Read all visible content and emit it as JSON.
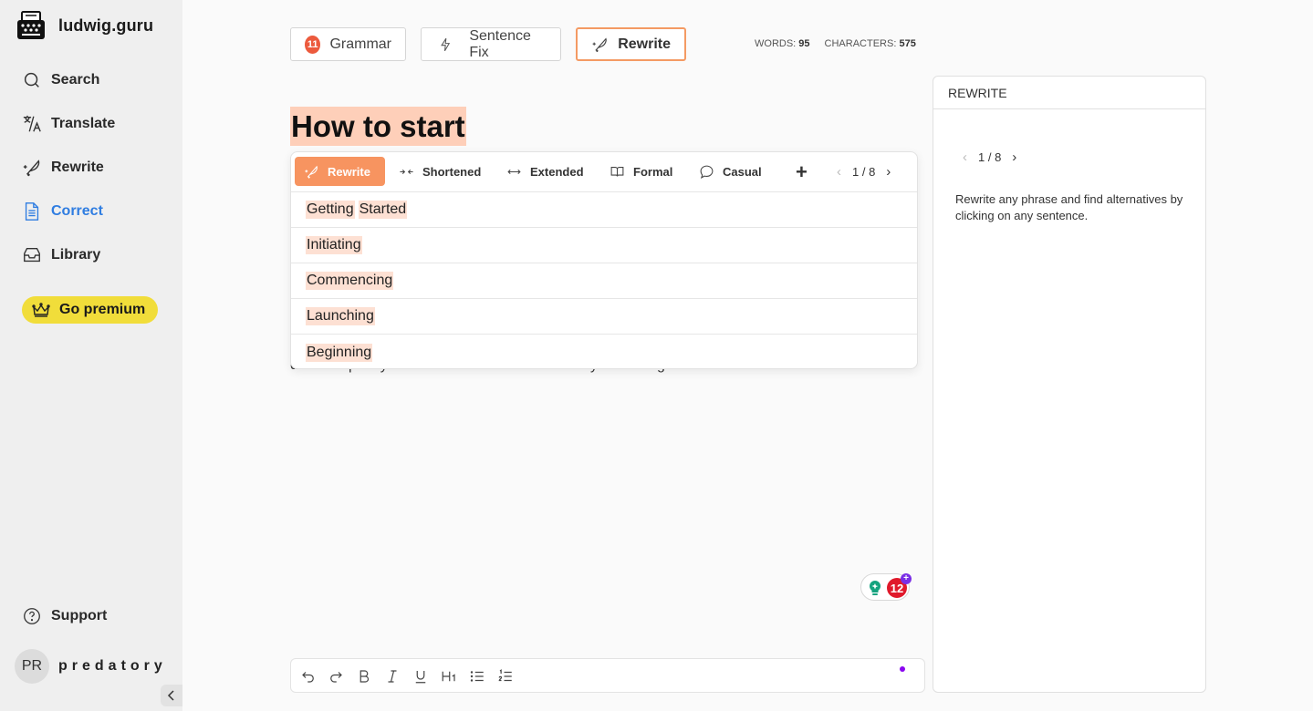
{
  "app": {
    "name": "ludwig.guru"
  },
  "sidebar": {
    "items": [
      {
        "label": "Search",
        "icon": "search-icon"
      },
      {
        "label": "Translate",
        "icon": "translate-icon"
      },
      {
        "label": "Rewrite",
        "icon": "quill-sparkle-icon"
      },
      {
        "label": "Correct",
        "icon": "document-icon",
        "active": true
      },
      {
        "label": "Library",
        "icon": "inbox-icon"
      }
    ],
    "premium_label": "Go premium",
    "support_label": "Support",
    "user": {
      "initials": "PR",
      "name": "predatory"
    }
  },
  "toolbar": {
    "grammar": {
      "label": "Grammar",
      "count": "11"
    },
    "sentence_fix": {
      "label": "Sentence Fix"
    },
    "rewrite": {
      "label": "Rewrite",
      "active": true
    },
    "words_label": "WORDS:",
    "words": "95",
    "characters_label": "CHARACTERS:",
    "characters": "575"
  },
  "editor": {
    "title": "How to start",
    "visible_paragraph_fragment": "discover plenty of rewrite alternatives to make your writing flow even smoother."
  },
  "rewrite_popup": {
    "tabs": [
      {
        "label": "Rewrite",
        "icon": "quill-sparkle-icon",
        "active": true
      },
      {
        "label": "Shortened",
        "icon": "shorten-arrows-icon"
      },
      {
        "label": "Extended",
        "icon": "extend-arrows-icon"
      },
      {
        "label": "Formal",
        "icon": "book-icon"
      },
      {
        "label": "Casual",
        "icon": "speech-bubble-icon"
      }
    ],
    "add_label": "+",
    "pager": "1 / 8",
    "alternatives": [
      [
        "Getting",
        "Started"
      ],
      [
        "Initiating"
      ],
      [
        "Commencing"
      ],
      [
        "Launching"
      ],
      [
        "Beginning"
      ]
    ]
  },
  "grammarly": {
    "count": "12",
    "plus": "+"
  },
  "format_toolbar": {
    "buttons": [
      "undo",
      "redo",
      "bold",
      "italic",
      "underline",
      "heading-1",
      "bullet-list",
      "numbered-list"
    ]
  },
  "right_panel": {
    "title": "REWRITE",
    "pager": "1 / 8",
    "description": "Rewrite any phrase and find alternatives by clicking on any sentence."
  },
  "colors": {
    "accent_orange": "#f79460",
    "highlight": "#fecfb9",
    "active_link": "#2f7de1",
    "premium": "#f1dd3a",
    "grammar_badge": "#ec5a3d"
  }
}
